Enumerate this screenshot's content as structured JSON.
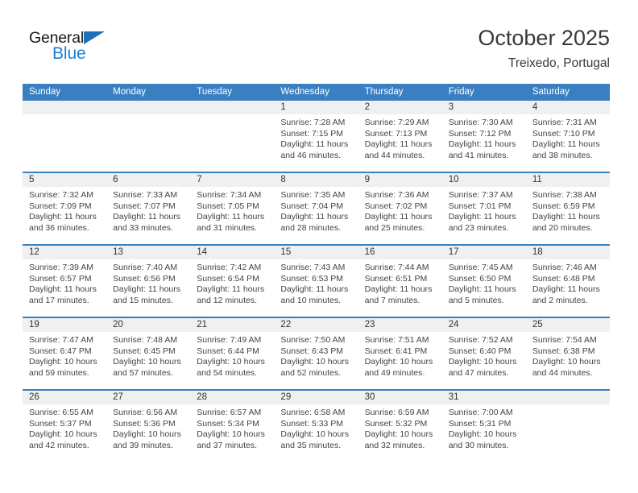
{
  "brand": {
    "name_top": "General",
    "name_bottom": "Blue",
    "accent_blue": "#1a7fd4",
    "flag_blue": "#1c71b8"
  },
  "header": {
    "title": "October 2025",
    "location": "Treixedo, Portugal"
  },
  "theme": {
    "header_blue": "#3a7fc1",
    "daynum_band": "#f0f0f0",
    "text": "#444444"
  },
  "calendar": {
    "weekday_headers": [
      "Sunday",
      "Monday",
      "Tuesday",
      "Wednesday",
      "Thursday",
      "Friday",
      "Saturday"
    ],
    "weeks": [
      [
        {
          "day": "",
          "empty": true,
          "lines": []
        },
        {
          "day": "",
          "empty": true,
          "lines": []
        },
        {
          "day": "",
          "empty": true,
          "lines": []
        },
        {
          "day": "1",
          "empty": false,
          "lines": [
            "Sunrise: 7:28 AM",
            "Sunset: 7:15 PM",
            "Daylight: 11 hours",
            "and 46 minutes."
          ]
        },
        {
          "day": "2",
          "empty": false,
          "lines": [
            "Sunrise: 7:29 AM",
            "Sunset: 7:13 PM",
            "Daylight: 11 hours",
            "and 44 minutes."
          ]
        },
        {
          "day": "3",
          "empty": false,
          "lines": [
            "Sunrise: 7:30 AM",
            "Sunset: 7:12 PM",
            "Daylight: 11 hours",
            "and 41 minutes."
          ]
        },
        {
          "day": "4",
          "empty": false,
          "lines": [
            "Sunrise: 7:31 AM",
            "Sunset: 7:10 PM",
            "Daylight: 11 hours",
            "and 38 minutes."
          ]
        }
      ],
      [
        {
          "day": "5",
          "empty": false,
          "lines": [
            "Sunrise: 7:32 AM",
            "Sunset: 7:09 PM",
            "Daylight: 11 hours",
            "and 36 minutes."
          ]
        },
        {
          "day": "6",
          "empty": false,
          "lines": [
            "Sunrise: 7:33 AM",
            "Sunset: 7:07 PM",
            "Daylight: 11 hours",
            "and 33 minutes."
          ]
        },
        {
          "day": "7",
          "empty": false,
          "lines": [
            "Sunrise: 7:34 AM",
            "Sunset: 7:05 PM",
            "Daylight: 11 hours",
            "and 31 minutes."
          ]
        },
        {
          "day": "8",
          "empty": false,
          "lines": [
            "Sunrise: 7:35 AM",
            "Sunset: 7:04 PM",
            "Daylight: 11 hours",
            "and 28 minutes."
          ]
        },
        {
          "day": "9",
          "empty": false,
          "lines": [
            "Sunrise: 7:36 AM",
            "Sunset: 7:02 PM",
            "Daylight: 11 hours",
            "and 25 minutes."
          ]
        },
        {
          "day": "10",
          "empty": false,
          "lines": [
            "Sunrise: 7:37 AM",
            "Sunset: 7:01 PM",
            "Daylight: 11 hours",
            "and 23 minutes."
          ]
        },
        {
          "day": "11",
          "empty": false,
          "lines": [
            "Sunrise: 7:38 AM",
            "Sunset: 6:59 PM",
            "Daylight: 11 hours",
            "and 20 minutes."
          ]
        }
      ],
      [
        {
          "day": "12",
          "empty": false,
          "lines": [
            "Sunrise: 7:39 AM",
            "Sunset: 6:57 PM",
            "Daylight: 11 hours",
            "and 17 minutes."
          ]
        },
        {
          "day": "13",
          "empty": false,
          "lines": [
            "Sunrise: 7:40 AM",
            "Sunset: 6:56 PM",
            "Daylight: 11 hours",
            "and 15 minutes."
          ]
        },
        {
          "day": "14",
          "empty": false,
          "lines": [
            "Sunrise: 7:42 AM",
            "Sunset: 6:54 PM",
            "Daylight: 11 hours",
            "and 12 minutes."
          ]
        },
        {
          "day": "15",
          "empty": false,
          "lines": [
            "Sunrise: 7:43 AM",
            "Sunset: 6:53 PM",
            "Daylight: 11 hours",
            "and 10 minutes."
          ]
        },
        {
          "day": "16",
          "empty": false,
          "lines": [
            "Sunrise: 7:44 AM",
            "Sunset: 6:51 PM",
            "Daylight: 11 hours",
            "and 7 minutes."
          ]
        },
        {
          "day": "17",
          "empty": false,
          "lines": [
            "Sunrise: 7:45 AM",
            "Sunset: 6:50 PM",
            "Daylight: 11 hours",
            "and 5 minutes."
          ]
        },
        {
          "day": "18",
          "empty": false,
          "lines": [
            "Sunrise: 7:46 AM",
            "Sunset: 6:48 PM",
            "Daylight: 11 hours",
            "and 2 minutes."
          ]
        }
      ],
      [
        {
          "day": "19",
          "empty": false,
          "lines": [
            "Sunrise: 7:47 AM",
            "Sunset: 6:47 PM",
            "Daylight: 10 hours",
            "and 59 minutes."
          ]
        },
        {
          "day": "20",
          "empty": false,
          "lines": [
            "Sunrise: 7:48 AM",
            "Sunset: 6:45 PM",
            "Daylight: 10 hours",
            "and 57 minutes."
          ]
        },
        {
          "day": "21",
          "empty": false,
          "lines": [
            "Sunrise: 7:49 AM",
            "Sunset: 6:44 PM",
            "Daylight: 10 hours",
            "and 54 minutes."
          ]
        },
        {
          "day": "22",
          "empty": false,
          "lines": [
            "Sunrise: 7:50 AM",
            "Sunset: 6:43 PM",
            "Daylight: 10 hours",
            "and 52 minutes."
          ]
        },
        {
          "day": "23",
          "empty": false,
          "lines": [
            "Sunrise: 7:51 AM",
            "Sunset: 6:41 PM",
            "Daylight: 10 hours",
            "and 49 minutes."
          ]
        },
        {
          "day": "24",
          "empty": false,
          "lines": [
            "Sunrise: 7:52 AM",
            "Sunset: 6:40 PM",
            "Daylight: 10 hours",
            "and 47 minutes."
          ]
        },
        {
          "day": "25",
          "empty": false,
          "lines": [
            "Sunrise: 7:54 AM",
            "Sunset: 6:38 PM",
            "Daylight: 10 hours",
            "and 44 minutes."
          ]
        }
      ],
      [
        {
          "day": "26",
          "empty": false,
          "lines": [
            "Sunrise: 6:55 AM",
            "Sunset: 5:37 PM",
            "Daylight: 10 hours",
            "and 42 minutes."
          ]
        },
        {
          "day": "27",
          "empty": false,
          "lines": [
            "Sunrise: 6:56 AM",
            "Sunset: 5:36 PM",
            "Daylight: 10 hours",
            "and 39 minutes."
          ]
        },
        {
          "day": "28",
          "empty": false,
          "lines": [
            "Sunrise: 6:57 AM",
            "Sunset: 5:34 PM",
            "Daylight: 10 hours",
            "and 37 minutes."
          ]
        },
        {
          "day": "29",
          "empty": false,
          "lines": [
            "Sunrise: 6:58 AM",
            "Sunset: 5:33 PM",
            "Daylight: 10 hours",
            "and 35 minutes."
          ]
        },
        {
          "day": "30",
          "empty": false,
          "lines": [
            "Sunrise: 6:59 AM",
            "Sunset: 5:32 PM",
            "Daylight: 10 hours",
            "and 32 minutes."
          ]
        },
        {
          "day": "31",
          "empty": false,
          "lines": [
            "Sunrise: 7:00 AM",
            "Sunset: 5:31 PM",
            "Daylight: 10 hours",
            "and 30 minutes."
          ]
        },
        {
          "day": "",
          "empty": true,
          "lines": []
        }
      ]
    ]
  }
}
